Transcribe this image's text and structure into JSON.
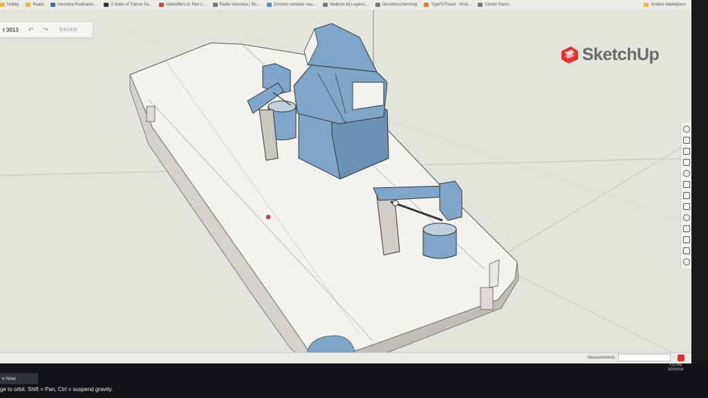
{
  "bookmarks": [
    {
      "label": "Hobby",
      "icon": "folder-icon",
      "color": "#e8b84a"
    },
    {
      "label": "Roald",
      "icon": "folder-icon",
      "color": "#e8b84a"
    },
    {
      "label": "Veronica Rockradio...",
      "icon": "veronica-icon",
      "color": "#3a6fb5"
    },
    {
      "label": "A State of Trance Se...",
      "icon": "asot-icon",
      "color": "#333333"
    },
    {
      "label": "Allekoffers.nl: Reli c...",
      "icon": "page-icon",
      "color": "#c44"
    },
    {
      "label": "Radio Veronica | Str...",
      "icon": "globe-icon",
      "color": "#777"
    },
    {
      "label": "Zimmen vertalen naa...",
      "icon": "translate-icon",
      "color": "#4a8fd1"
    },
    {
      "label": "Welkom bij Legans...",
      "icon": "globe-icon",
      "color": "#777"
    },
    {
      "label": "Oeverbescherming",
      "icon": "globe-icon",
      "color": "#777"
    },
    {
      "label": "TypeToTravel - Vind...",
      "icon": "page-icon",
      "color": "#e07b2a"
    },
    {
      "label": "Center Parcs",
      "icon": "page-icon",
      "color": "#777"
    }
  ],
  "other_bookmarks": "Andere bladwijzers",
  "toolbar": {
    "title": "t 3013",
    "undo_icon": "undo-icon",
    "redo_icon": "redo-icon",
    "saved_label": "SAVED"
  },
  "logo": {
    "text": "SketchUp",
    "color": "#e2322f"
  },
  "status": {
    "measurements_label": "Measurements",
    "hint": "ge to orbit. Shift = Pan, Ctrl = suspend gravity.",
    "join_now": "e Now",
    "tray_time": "7:21 PM",
    "tray_date": "5/20/2018"
  },
  "right_panel_icons": [
    "entity-info-icon",
    "instructor-icon",
    "materials-icon",
    "components-icon",
    "styles-icon",
    "layers-icon",
    "scenes-icon",
    "shadows-icon",
    "display-icon",
    "outliner-icon",
    "link-icon",
    "screenshot-icon",
    "warehouse-icon"
  ],
  "colors": {
    "model_blue": "#7ea6c9",
    "model_white": "#f2f1ed",
    "viewport": "#e4e3dc"
  }
}
